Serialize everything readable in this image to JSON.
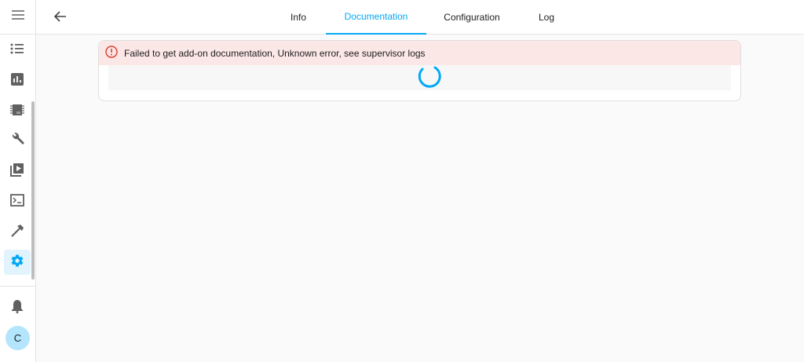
{
  "sidebar": {
    "items": [
      {
        "icon": "menu-icon"
      },
      {
        "icon": "list-icon"
      },
      {
        "icon": "chart-icon"
      },
      {
        "icon": "chip-icon"
      },
      {
        "icon": "wrench-icon"
      },
      {
        "icon": "media-icon"
      },
      {
        "icon": "terminal-icon"
      },
      {
        "icon": "hammer-icon"
      },
      {
        "icon": "gear-icon",
        "active": true
      },
      {
        "icon": "bell-icon"
      }
    ],
    "avatar": "C"
  },
  "header": {
    "tabs": [
      {
        "label": "Info"
      },
      {
        "label": "Documentation",
        "active": true
      },
      {
        "label": "Configuration"
      },
      {
        "label": "Log"
      }
    ]
  },
  "card": {
    "error": "Failed to get add-on documentation, Unknown error, see supervisor logs"
  },
  "colors": {
    "accent": "#03a9f4",
    "error": "#db4437",
    "error_bg": "#fbe7e6"
  }
}
